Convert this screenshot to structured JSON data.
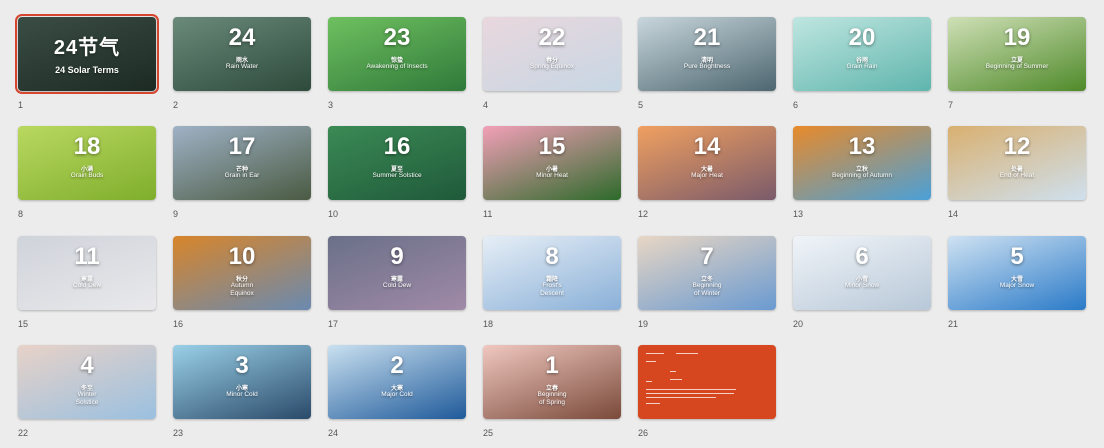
{
  "slides": [
    {
      "label": "1",
      "num": "24节气",
      "cn": "",
      "en": "24 Solar Terms",
      "sub": "",
      "bg": "#1d2a24",
      "bg2": "#3a4d44",
      "selected": true,
      "type": "title"
    },
    {
      "label": "2",
      "num": "24",
      "cn": "雨水",
      "en": "Rain Water",
      "sub": "",
      "bg": "#2d4a3b",
      "bg2": "#6a8a7a"
    },
    {
      "label": "3",
      "num": "23",
      "cn": "惊蛰",
      "en": "Awakening of Insects",
      "sub": "",
      "bg": "#2f7a3a",
      "bg2": "#6fc060"
    },
    {
      "label": "4",
      "num": "22",
      "cn": "春分",
      "en": "Spring Equinox",
      "sub": "",
      "bg": "#c7d7e4",
      "bg2": "#e9d7dd"
    },
    {
      "label": "5",
      "num": "21",
      "cn": "清明",
      "en": "Pure Brightness",
      "sub": "",
      "bg": "#4d6670",
      "bg2": "#c8d6dc"
    },
    {
      "label": "6",
      "num": "20",
      "cn": "谷雨",
      "en": "Grain Rain",
      "sub": "",
      "bg": "#5fb5ad",
      "bg2": "#bfe6e0"
    },
    {
      "label": "7",
      "num": "19",
      "cn": "立夏",
      "en": "Beginning of Summer",
      "sub": "",
      "bg": "#4f8a2a",
      "bg2": "#cfe0b6"
    },
    {
      "label": "8",
      "num": "18",
      "cn": "小满",
      "en": "Grain Buds",
      "sub": "",
      "bg": "#7fae2c",
      "bg2": "#b9d860"
    },
    {
      "label": "9",
      "num": "17",
      "cn": "芒种",
      "en": "Grain in Ear",
      "sub": "",
      "bg": "#4a5a42",
      "bg2": "#9fb2c6"
    },
    {
      "label": "10",
      "num": "16",
      "cn": "夏至",
      "en": "Summer Solstice",
      "sub": "",
      "bg": "#1f5a3a",
      "bg2": "#3b8a55"
    },
    {
      "label": "11",
      "num": "15",
      "cn": "小暑",
      "en": "Minor Heat",
      "sub": "",
      "bg": "#2d6a2a",
      "bg2": "#f3a0b8"
    },
    {
      "label": "12",
      "num": "14",
      "cn": "大暑",
      "en": "Major Heat",
      "sub": "",
      "bg": "#7a5a6a",
      "bg2": "#f0a060"
    },
    {
      "label": "13",
      "num": "13",
      "cn": "立秋",
      "en": "Beginning of Autumn",
      "sub": "",
      "bg": "#4aa0d8",
      "bg2": "#e88a2a"
    },
    {
      "label": "14",
      "num": "12",
      "cn": "处暑",
      "en": "End of Heat",
      "sub": "",
      "bg": "#cfe0ee",
      "bg2": "#d9b070"
    },
    {
      "label": "15",
      "num": "11",
      "cn": "寒露",
      "en": "Cold Dew",
      "sub": "",
      "bg": "#e9e9ec",
      "bg2": "#cfd3da"
    },
    {
      "label": "16",
      "num": "10",
      "cn": "秋分",
      "en": "Autumn\nEquinox",
      "sub": "",
      "bg": "#6a8ab0",
      "bg2": "#d8852a"
    },
    {
      "label": "17",
      "num": "9",
      "cn": "寒露",
      "en": "Cold Dew",
      "sub": "",
      "bg": "#a08aa8",
      "bg2": "#6a7088"
    },
    {
      "label": "18",
      "num": "8",
      "cn": "霜降",
      "en": "Frost's\nDescent",
      "sub": "",
      "bg": "#8ab0d8",
      "bg2": "#e6eef6"
    },
    {
      "label": "19",
      "num": "7",
      "cn": "立冬",
      "en": "Beginning\nof Winter",
      "sub": "",
      "bg": "#6a9ad0",
      "bg2": "#e8d6c4"
    },
    {
      "label": "20",
      "num": "6",
      "cn": "小雪",
      "en": "Minor Snow",
      "sub": "",
      "bg": "#b8c8d8",
      "bg2": "#f0f4f8"
    },
    {
      "label": "21",
      "num": "5",
      "cn": "大雪",
      "en": "Major Snow",
      "sub": "",
      "bg": "#2a7ac8",
      "bg2": "#cfe2f2"
    },
    {
      "label": "22",
      "num": "4",
      "cn": "冬至",
      "en": "Winter\nSolstice",
      "sub": "",
      "bg": "#9ac0e0",
      "bg2": "#e8d2c8"
    },
    {
      "label": "23",
      "num": "3",
      "cn": "小寒",
      "en": "Minor Cold",
      "sub": "",
      "bg": "#2a4a6a",
      "bg2": "#9ad0e8"
    },
    {
      "label": "24",
      "num": "2",
      "cn": "大寒",
      "en": "Major Cold",
      "sub": "",
      "bg": "#1f5a9a",
      "bg2": "#c9e0f0"
    },
    {
      "label": "25",
      "num": "1",
      "cn": "立春",
      "en": "Beginning\nof Spring",
      "sub": "",
      "bg": "#7a4a3a",
      "bg2": "#f0c8c0"
    },
    {
      "label": "26",
      "num": "",
      "cn": "",
      "en": "",
      "sub": "",
      "bg": "#d6461f",
      "bg2": "#d6461f",
      "type": "text"
    }
  ]
}
